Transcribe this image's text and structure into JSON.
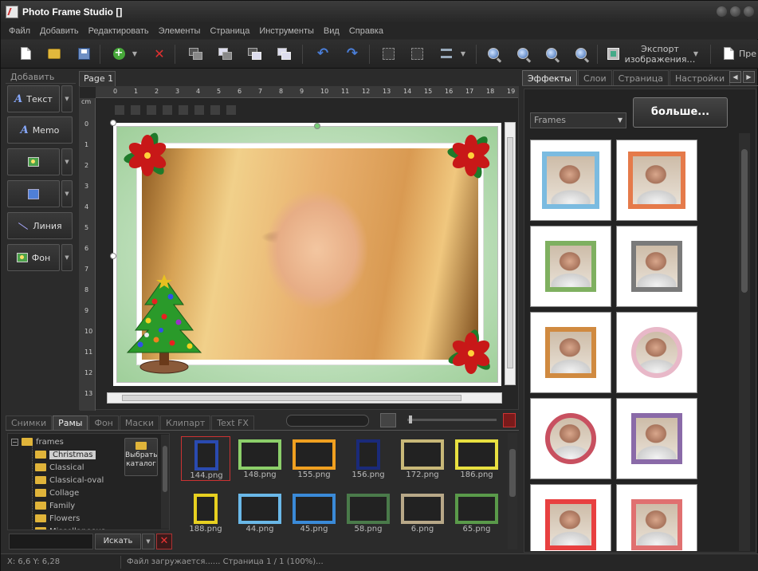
{
  "app": {
    "title": "Photo Frame Studio []"
  },
  "menu": [
    "Файл",
    "Добавить",
    "Редактировать",
    "Элементы",
    "Страница",
    "Инструменты",
    "Вид",
    "Справка"
  ],
  "toolbar": {
    "export_label": "Экспорт изображения…",
    "preview_label": "Пре"
  },
  "left_panel": {
    "tab": "Добавить",
    "buttons": {
      "text": "Текст",
      "memo": "Memo",
      "line": "Линия",
      "background": "Фон"
    }
  },
  "page_tab": "Page 1",
  "ruler": {
    "unit": "cm",
    "h_ticks": [
      "0",
      "1",
      "2",
      "3",
      "4",
      "5",
      "6",
      "7",
      "8",
      "9",
      "10",
      "11",
      "12",
      "13",
      "14",
      "15",
      "16",
      "17",
      "18",
      "19"
    ],
    "v_ticks": [
      "0",
      "1",
      "2",
      "3",
      "4",
      "5",
      "6",
      "7",
      "8",
      "9",
      "10",
      "11",
      "12",
      "13"
    ]
  },
  "bottom": {
    "tabs": [
      "Снимки",
      "Рамы",
      "Фон",
      "Маски",
      "Клипарт",
      "Text FX"
    ],
    "active_tab": "Рамы",
    "tree": {
      "root": "frames",
      "items": [
        "Christmas",
        "Classical",
        "Classical-oval",
        "Collage",
        "Family",
        "Flowers",
        "Miscellaneous"
      ],
      "selected": "Christmas"
    },
    "choose_folder": "Выбрать каталог",
    "search_label": "Искать",
    "thumbnails": [
      {
        "name": "144.png",
        "color": "#2a4ab0",
        "selected": true,
        "tall": true
      },
      {
        "name": "148.png",
        "color": "#8ccf6a"
      },
      {
        "name": "155.png",
        "color": "#f0a020"
      },
      {
        "name": "156.png",
        "color": "#1a2a7a",
        "tall": true
      },
      {
        "name": "172.png",
        "color": "#c8b878"
      },
      {
        "name": "186.png",
        "color": "#e8e040"
      },
      {
        "name": "188.png",
        "color": "#e8d020",
        "tall": true
      },
      {
        "name": "44.png",
        "color": "#6ab8e8"
      },
      {
        "name": "45.png",
        "color": "#3a8ad8"
      },
      {
        "name": "58.png",
        "color": "#4a7a4a"
      },
      {
        "name": "6.png",
        "color": "#b8a888"
      },
      {
        "name": "65.png",
        "color": "#5a9a4a"
      }
    ]
  },
  "right_panel": {
    "tabs": [
      "Эффекты",
      "Слои",
      "Страница",
      "Настройки"
    ],
    "active_tab": "Эффекты",
    "dropdown": "Frames",
    "more_button": "больше...",
    "frame_colors": [
      "#7bbbe0",
      "#e57a4a",
      "#7fb060",
      "#7a7a7a",
      "#d08a40",
      "#e8b8c8",
      "#c85060",
      "#8a6aa8",
      "#e84040",
      "#e07070"
    ],
    "round": [
      false,
      false,
      false,
      false,
      false,
      true,
      true,
      false,
      false,
      false
    ]
  },
  "status": {
    "position": "X: 6,6 Y: 6,28",
    "message": "Файл загружается...... Страница 1 / 1 (100%)..."
  }
}
